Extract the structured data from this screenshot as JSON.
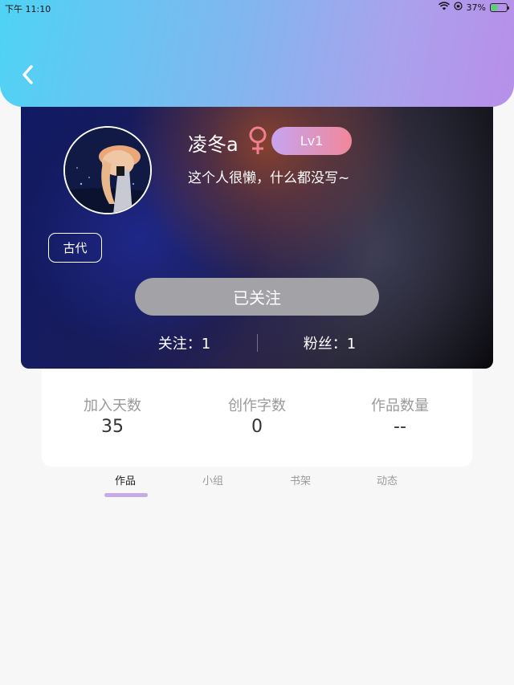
{
  "status_bar": {
    "time": "下午 11:10",
    "battery": "37%",
    "battery_level": 0.37
  },
  "header": {
    "back_icon": "chevron-left-icon"
  },
  "profile": {
    "username": "凌冬a",
    "gender_icon": "female-icon",
    "gender_color": "#f0808f",
    "level": "Lv1",
    "bio": "这个人很懒，什么都没写~",
    "tag": "古代",
    "follow_button": "已关注",
    "following": "关注：1",
    "fans": "粉丝：1"
  },
  "stats": [
    {
      "label": "加入天数",
      "value": "35"
    },
    {
      "label": "创作字数",
      "value": "0"
    },
    {
      "label": "作品数量",
      "value": "--"
    }
  ],
  "tabs": [
    {
      "label": "作品",
      "active": true
    },
    {
      "label": "小组",
      "active": false
    },
    {
      "label": "书架",
      "active": false
    },
    {
      "label": "动态",
      "active": false
    }
  ],
  "colors": {
    "header_gradient_start": "#4fd3f5",
    "header_gradient_end": "#b88fe9",
    "level_badge_start": "#c7a4f0",
    "level_badge_end": "#f1879a",
    "tab_indicator": "#c6abe6"
  }
}
